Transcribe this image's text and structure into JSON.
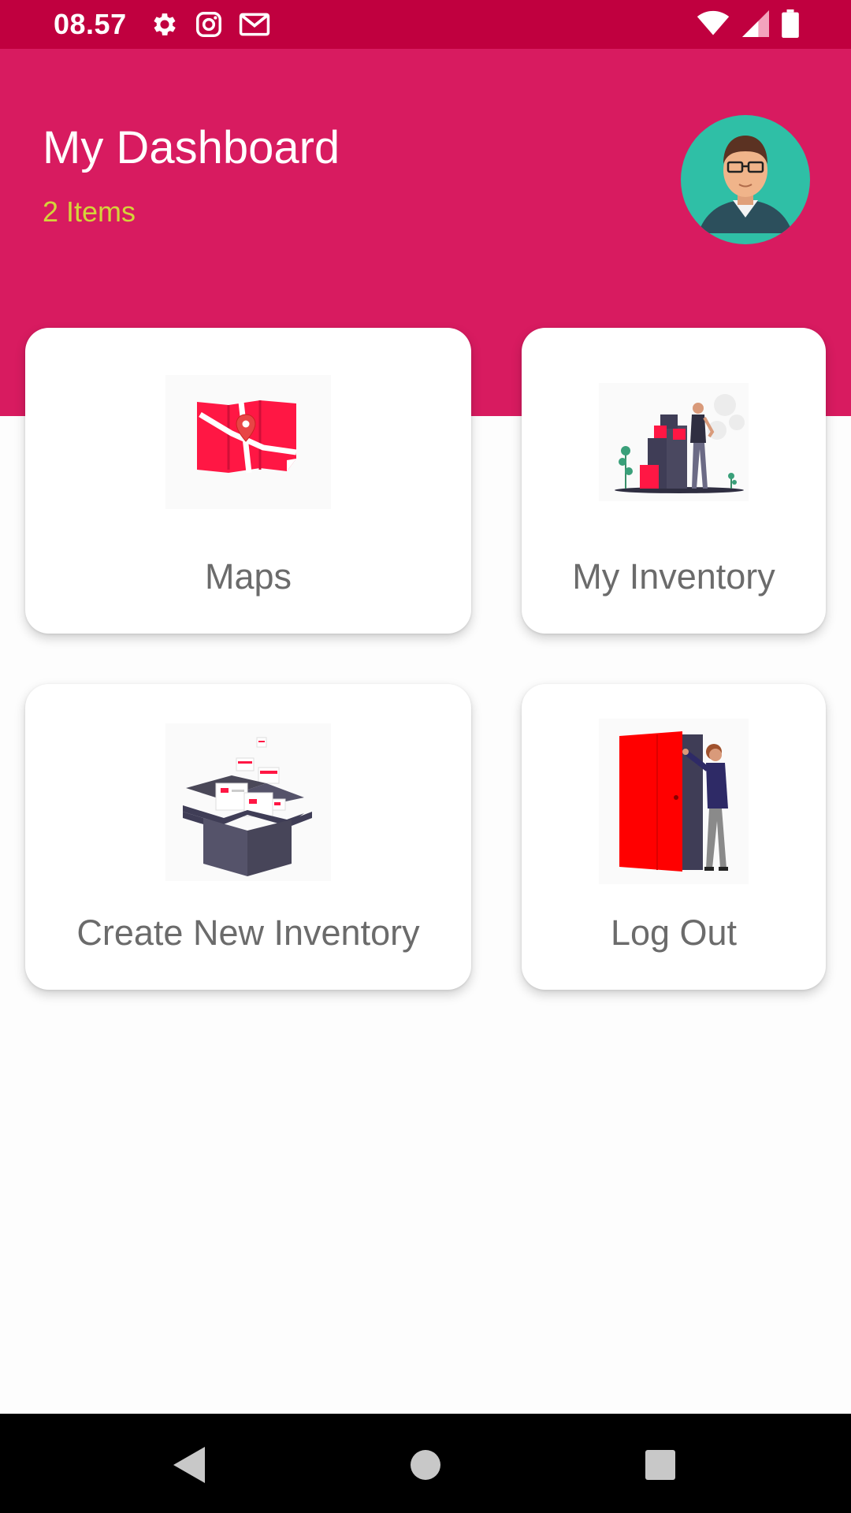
{
  "status_bar": {
    "time": "08.57",
    "left_icons": [
      "gear-icon",
      "instagram-icon",
      "gmail-icon"
    ],
    "right_icons": [
      "wifi-icon",
      "signal-icon",
      "battery-icon"
    ]
  },
  "header": {
    "title": "My Dashboard",
    "subtitle": "2 Items",
    "avatar_icon": "user-avatar-icon"
  },
  "cards": [
    {
      "label": "Maps",
      "icon": "map-illustration-icon"
    },
    {
      "label": "My Inventory",
      "icon": "inventory-boxes-illustration-icon"
    },
    {
      "label": "Create New Inventory",
      "icon": "open-box-illustration-icon"
    },
    {
      "label": "Log Out",
      "icon": "door-exit-illustration-icon"
    }
  ],
  "nav_bar": {
    "buttons": [
      "back-icon",
      "home-icon",
      "recents-icon"
    ]
  },
  "colors": {
    "status_bar": "#c0003f",
    "header": "#d81b60",
    "subtitle": "#d4d43a",
    "accent_red": "#ff1744"
  }
}
